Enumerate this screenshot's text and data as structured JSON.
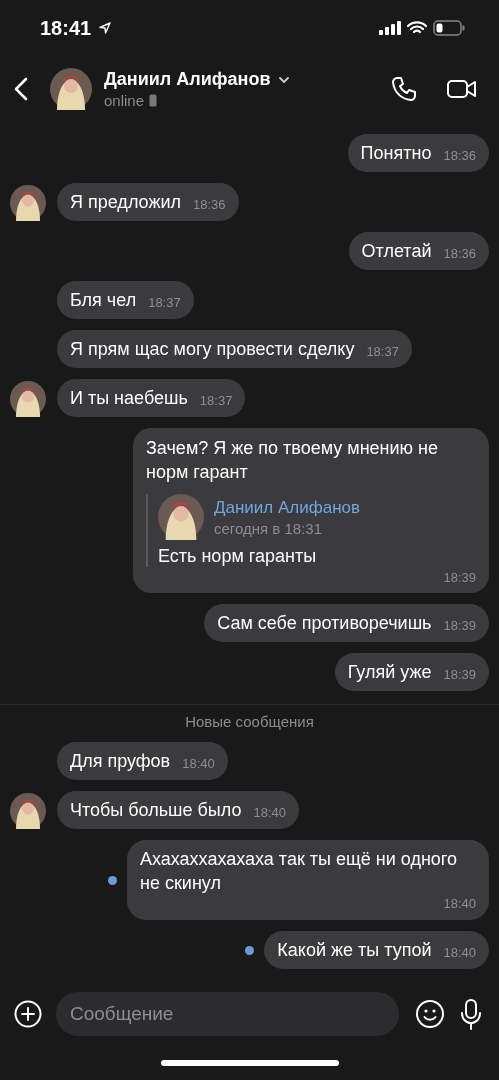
{
  "status_bar": {
    "time": "18:41"
  },
  "header": {
    "name": "Даниил Алифанов",
    "status": "online"
  },
  "messages": [
    {
      "kind": "out",
      "text": "Понятно",
      "time": "18:36",
      "unread": false
    },
    {
      "kind": "in",
      "text": "Я предложил",
      "time": "18:36",
      "avatar": true
    },
    {
      "kind": "out",
      "text": "Отлетай",
      "time": "18:36",
      "unread": false
    },
    {
      "kind": "in",
      "text": "Бля чел",
      "time": "18:37",
      "avatar": false
    },
    {
      "kind": "in",
      "text": "Я прям щас могу провести сделку",
      "time": "18:37",
      "avatar": false
    },
    {
      "kind": "in",
      "text": "И ты наебешь",
      "time": "18:37",
      "avatar": true
    },
    {
      "kind": "out",
      "text": "Зачем? Я же по твоему мнению не норм гарант",
      "time": "18:39",
      "unread": false,
      "reply": {
        "author": "Даниил Алифанов",
        "date": "сегодня в 18:31",
        "text": "Есть норм гаранты"
      }
    },
    {
      "kind": "out",
      "text": "Сам себе противоречишь",
      "time": "18:39",
      "unread": false
    },
    {
      "kind": "out",
      "text": "Гуляй уже",
      "time": "18:39",
      "unread": false
    },
    {
      "kind": "divider",
      "text": "Новые сообщения"
    },
    {
      "kind": "in",
      "text": "Для пруфов",
      "time": "18:40",
      "avatar": false
    },
    {
      "kind": "in",
      "text": "Чтобы больше было",
      "time": "18:40",
      "avatar": true
    },
    {
      "kind": "out",
      "text": "Ахахаххахахаха так ты ещё ни одного не скинул",
      "time": "18:40",
      "unread": true
    },
    {
      "kind": "out",
      "text": "Какой же ты тупой",
      "time": "18:40",
      "unread": true
    }
  ],
  "composer": {
    "placeholder": "Сообщение"
  }
}
